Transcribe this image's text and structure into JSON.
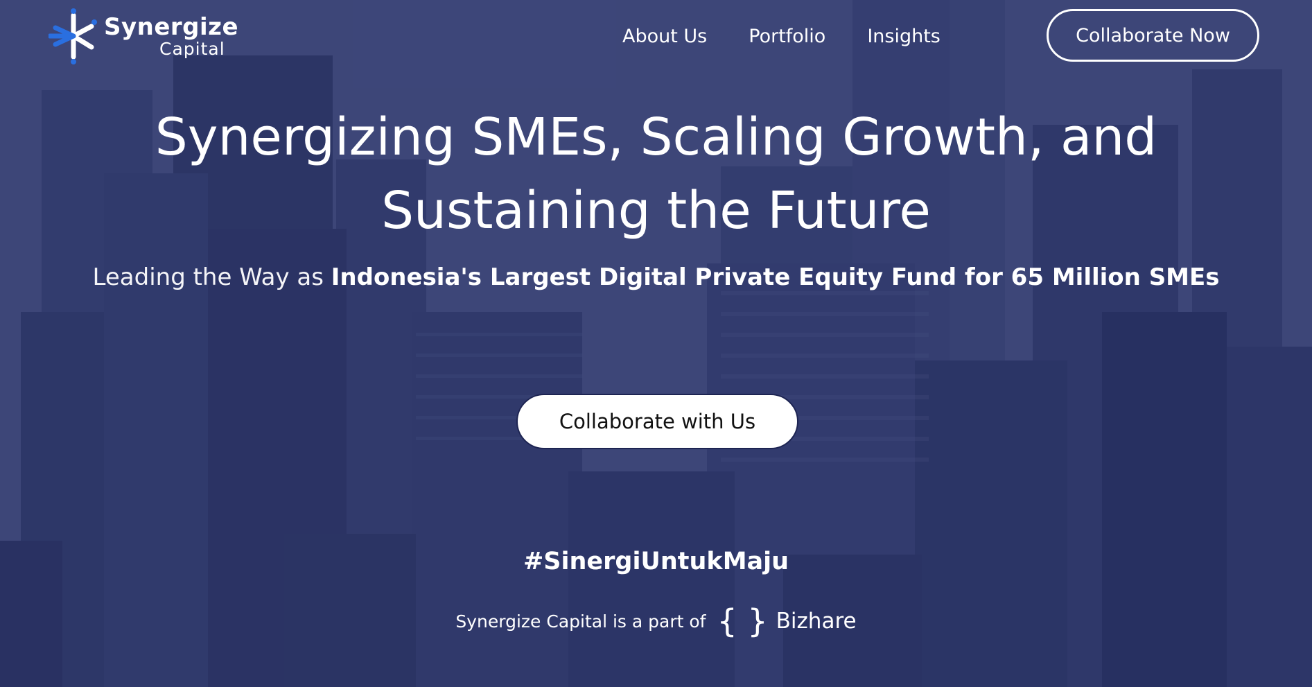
{
  "brand": {
    "name_line1": "Synergize",
    "name_line2": "Capital",
    "colors": {
      "accent": "#2a6fe0",
      "overlay": "#2c346e"
    }
  },
  "nav": {
    "items": [
      {
        "label": "About Us"
      },
      {
        "label": "Portfolio"
      },
      {
        "label": "Insights"
      }
    ],
    "cta_label": "Collaborate Now"
  },
  "hero": {
    "headline_line1": "Synergizing SMEs, Scaling Growth, and",
    "headline_line2": "Sustaining the Future",
    "sub_light": "Leading the Way as ",
    "sub_bold": "Indonesia's Largest Digital Private Equity Fund for 65 Million SMEs",
    "cta_label": "Collaborate with Us",
    "hashtag": "#SinergiUntukMaju",
    "part_of_text": "Synergize Capital is a part of",
    "partner_icon": "curly-braces-icon",
    "partner_name": "Bizhare"
  }
}
